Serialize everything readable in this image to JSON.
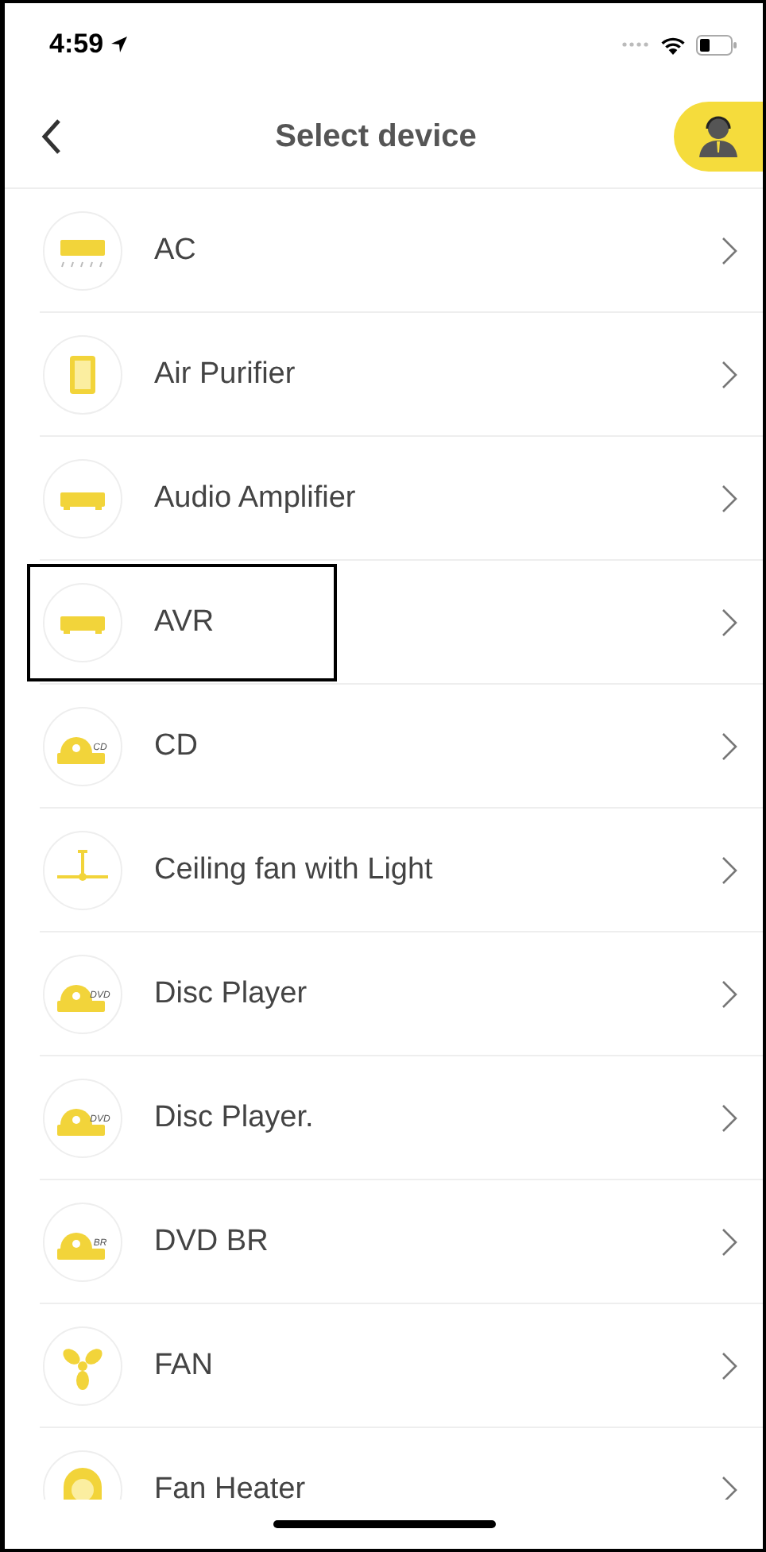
{
  "status_bar": {
    "time": "4:59"
  },
  "header": {
    "title": "Select device"
  },
  "devices": [
    {
      "name": "AC",
      "kind": "ac",
      "highlighted": false
    },
    {
      "name": "Air Purifier",
      "kind": "purifier",
      "highlighted": false
    },
    {
      "name": "Audio Amplifier",
      "kind": "amplifier",
      "highlighted": false
    },
    {
      "name": "AVR",
      "kind": "amplifier",
      "highlighted": true
    },
    {
      "name": "CD",
      "kind": "disc",
      "icon_label": "CD",
      "highlighted": false
    },
    {
      "name": "Ceiling fan with Light",
      "kind": "ceiling_fan",
      "highlighted": false
    },
    {
      "name": "Disc Player",
      "kind": "disc",
      "icon_label": "DVD",
      "highlighted": false
    },
    {
      "name": "Disc Player.",
      "kind": "disc",
      "icon_label": "DVD",
      "highlighted": false
    },
    {
      "name": "DVD BR",
      "kind": "disc",
      "icon_label": "BR",
      "highlighted": false
    },
    {
      "name": "FAN",
      "kind": "fan",
      "highlighted": false
    },
    {
      "name": "Fan Heater",
      "kind": "heater",
      "highlighted": false
    }
  ]
}
